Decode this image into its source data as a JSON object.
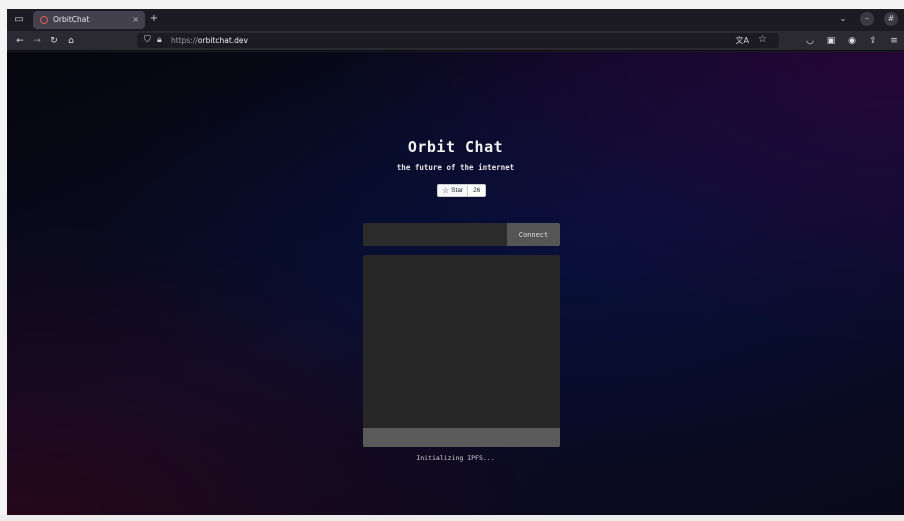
{
  "browser": {
    "tab": {
      "title": "OrbitChat",
      "close_glyph": "×"
    },
    "new_tab_glyph": "+",
    "url": {
      "prefix": "https://",
      "host": "orbitchat.dev"
    },
    "icons": {
      "window": "window-icon",
      "back": "back-arrow-icon",
      "forward": "forward-arrow-icon",
      "reload": "reload-icon",
      "home": "home-icon",
      "shield": "tracking-shield-icon",
      "lock": "lock-icon",
      "translate": "translate-icon",
      "bookmark": "bookmark-star-icon",
      "pocket": "pocket-icon",
      "reader": "sidebar-icon",
      "account": "account-icon",
      "extensions": "extensions-icon",
      "menu": "hamburger-menu-icon"
    }
  },
  "page": {
    "title": "Orbit Chat",
    "tagline": "the future of the internet",
    "github": {
      "star_label": "Star",
      "star_count": "26"
    },
    "connect": {
      "input_value": "",
      "button_label": "Connect"
    },
    "chat": {
      "input_value": ""
    },
    "status": "Initializing IPFS..."
  },
  "colors": {
    "chrome_bg": "#1c1b22",
    "navbar_bg": "#2b2a33",
    "connect_button": "#555555",
    "chat_panel": "#262626",
    "chat_input": "#5a5a5a"
  }
}
